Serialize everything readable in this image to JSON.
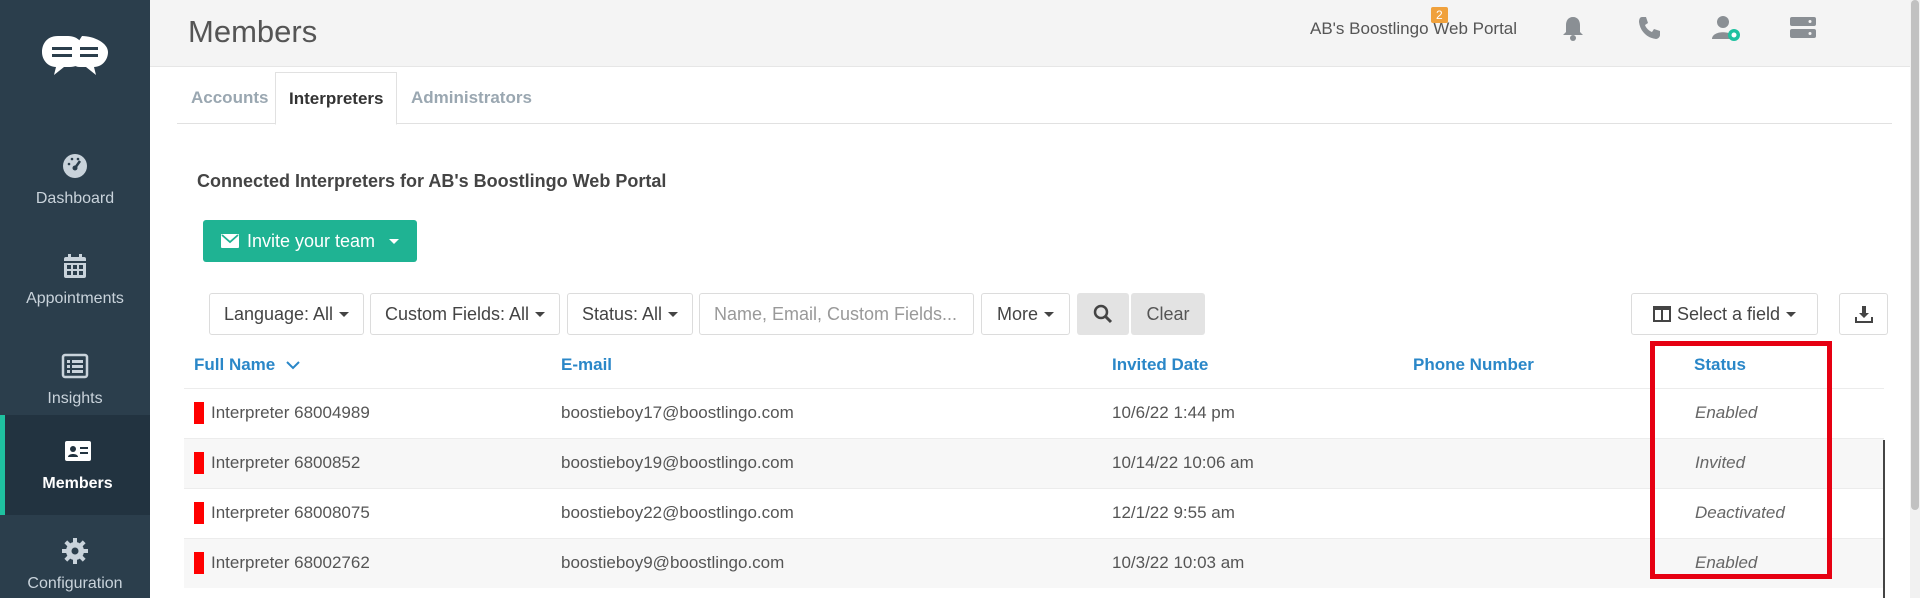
{
  "sidebar": {
    "items": [
      {
        "label": "Dashboard",
        "icon": "gauge-icon"
      },
      {
        "label": "Appointments",
        "icon": "calendar-icon"
      },
      {
        "label": "Insights",
        "icon": "list-icon"
      },
      {
        "label": "Members",
        "icon": "id-card-icon"
      },
      {
        "label": "Configuration",
        "icon": "gear-icon"
      }
    ],
    "active": "Members"
  },
  "header": {
    "title": "Members",
    "portal_name": "AB's Boostlingo Web Portal",
    "notification_count": "2"
  },
  "tabs": [
    {
      "label": "Accounts"
    },
    {
      "label": "Interpreters"
    },
    {
      "label": "Administrators"
    }
  ],
  "main": {
    "section_title": "Connected Interpreters for AB's Boostlingo Web Portal",
    "invite_label": "Invite your team"
  },
  "filters": {
    "language": "Language: All",
    "custom_fields": "Custom Fields: All",
    "status": "Status: All",
    "search_placeholder": "Name, Email, Custom Fields...",
    "more": "More",
    "clear": "Clear",
    "select_field": "Select a field"
  },
  "table": {
    "columns": [
      "Full Name",
      "E-mail",
      "Invited Date",
      "Phone Number",
      "Status"
    ],
    "rows": [
      {
        "name": "Interpreter 68004989",
        "email": "boostieboy17@boostlingo.com",
        "invited": "10/6/22 1:44 pm",
        "phone": "",
        "status": "Enabled"
      },
      {
        "name": "Interpreter 6800852",
        "email": "boostieboy19@boostlingo.com",
        "invited": "10/14/22 10:06 am",
        "phone": "",
        "status": "Invited"
      },
      {
        "name": "Interpreter 68008075",
        "email": "boostieboy22@boostlingo.com",
        "invited": "12/1/22 9:55 am",
        "phone": "",
        "status": "Deactivated"
      },
      {
        "name": "Interpreter 68002762",
        "email": "boostieboy9@boostlingo.com",
        "invited": "10/3/22 10:03 am",
        "phone": "",
        "status": "Enabled"
      }
    ]
  },
  "colors": {
    "sidebar": "#2b3e4c",
    "accent": "#1fb393",
    "link": "#2a87c8",
    "highlight": "#e60012",
    "badge": "#f0a13c"
  }
}
